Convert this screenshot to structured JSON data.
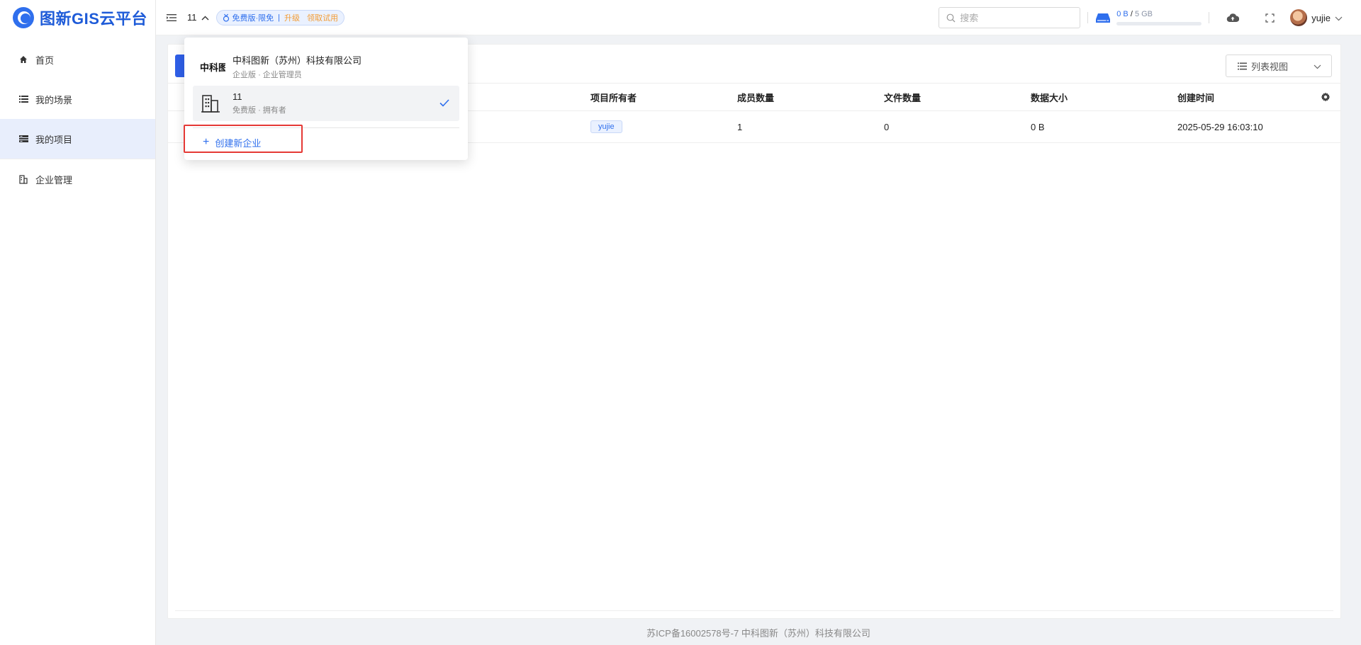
{
  "app": {
    "name": "图新GIS云平台",
    "brand_color": "#1e5bd8"
  },
  "sidebar": {
    "items": [
      {
        "label": "首页",
        "icon": "home-icon"
      },
      {
        "label": "我的场景",
        "icon": "list-icon"
      },
      {
        "label": "我的项目",
        "icon": "project-icon",
        "active": true
      },
      {
        "label": "企业管理",
        "icon": "building-icon"
      }
    ]
  },
  "header": {
    "current_org": "11",
    "plan": {
      "label": "免费版·限免",
      "separator": "|",
      "upgrade": "升级",
      "trial": "领取试用"
    },
    "search_placeholder": "搜索",
    "storage": {
      "used": "0 B",
      "slash": "/",
      "total": "5 GB",
      "fraction": 0
    },
    "user": "yujie"
  },
  "content": {
    "view_select": "列表视图",
    "table": {
      "columns": [
        "项目所有者",
        "成员数量",
        "文件数量",
        "数据大小",
        "创建时间"
      ],
      "rows": [
        {
          "owner": "yujie",
          "members": "1",
          "files": "0",
          "size": "0 B",
          "created": "2025-05-29 16:03:10"
        }
      ]
    }
  },
  "org_dropdown": {
    "orgs": [
      {
        "logo": "中科图新",
        "name": "中科图新（苏州）科技有限公司",
        "edition": "企业版",
        "role": "企业管理员",
        "selected": false
      },
      {
        "name": "11",
        "edition": "免费版",
        "role": "拥有者",
        "selected": true
      }
    ],
    "dot": "·",
    "create_label": "创建新企业"
  },
  "footer": {
    "text": "苏ICP备16002578号-7 中科图新（苏州）科技有限公司"
  },
  "colors": {
    "accent": "#2f6fed",
    "warning": "#f39c34",
    "highlight": "#e53935",
    "sidebar_active_bg": "#e8eefc"
  }
}
